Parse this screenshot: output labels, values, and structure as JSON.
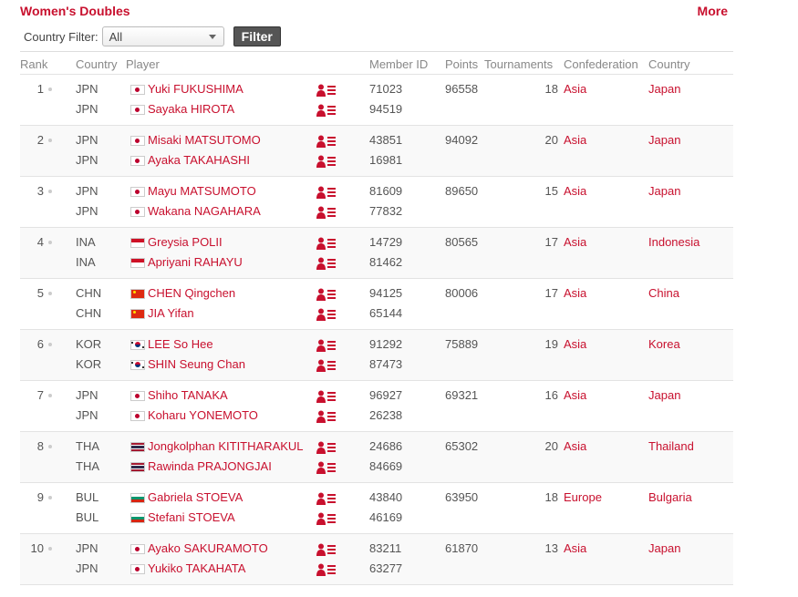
{
  "header": {
    "title": "Women's Doubles",
    "more": "More"
  },
  "filter": {
    "label": "Country Filter:",
    "selected": "All",
    "button": "Filter"
  },
  "columns": {
    "rank": "Rank",
    "country_code": "Country",
    "player": "Player",
    "member_id": "Member ID",
    "points": "Points",
    "tournaments": "Tournaments",
    "confederation": "Confederation",
    "country": "Country"
  },
  "icons": {
    "flag": "country-flag-icon",
    "profile": "player-profile-icon",
    "dot": "rank-change-dot-icon"
  },
  "colors": {
    "accent": "#c8102e"
  },
  "rows": [
    {
      "rank": "1",
      "points": "96558",
      "tournaments": "18",
      "confederation": "Asia",
      "country": "Japan",
      "players": [
        {
          "code": "JPN",
          "flag": "jp",
          "name": "Yuki FUKUSHIMA",
          "member_id": "71023"
        },
        {
          "code": "JPN",
          "flag": "jp",
          "name": "Sayaka HIROTA",
          "member_id": "94519"
        }
      ]
    },
    {
      "rank": "2",
      "points": "94092",
      "tournaments": "20",
      "confederation": "Asia",
      "country": "Japan",
      "players": [
        {
          "code": "JPN",
          "flag": "jp",
          "name": "Misaki MATSUTOMO",
          "member_id": "43851"
        },
        {
          "code": "JPN",
          "flag": "jp",
          "name": "Ayaka TAKAHASHI",
          "member_id": "16981"
        }
      ]
    },
    {
      "rank": "3",
      "points": "89650",
      "tournaments": "15",
      "confederation": "Asia",
      "country": "Japan",
      "players": [
        {
          "code": "JPN",
          "flag": "jp",
          "name": "Mayu MATSUMOTO",
          "member_id": "81609"
        },
        {
          "code": "JPN",
          "flag": "jp",
          "name": "Wakana NAGAHARA",
          "member_id": "77832"
        }
      ]
    },
    {
      "rank": "4",
      "points": "80565",
      "tournaments": "17",
      "confederation": "Asia",
      "country": "Indonesia",
      "players": [
        {
          "code": "INA",
          "flag": "id",
          "name": "Greysia POLII",
          "member_id": "14729"
        },
        {
          "code": "INA",
          "flag": "id",
          "name": "Apriyani RAHAYU",
          "member_id": "81462"
        }
      ]
    },
    {
      "rank": "5",
      "points": "80006",
      "tournaments": "17",
      "confederation": "Asia",
      "country": "China",
      "players": [
        {
          "code": "CHN",
          "flag": "cn",
          "name": "CHEN Qingchen",
          "member_id": "94125"
        },
        {
          "code": "CHN",
          "flag": "cn",
          "name": "JIA Yifan",
          "member_id": "65144"
        }
      ]
    },
    {
      "rank": "6",
      "points": "75889",
      "tournaments": "19",
      "confederation": "Asia",
      "country": "Korea",
      "players": [
        {
          "code": "KOR",
          "flag": "kr",
          "name": "LEE So Hee",
          "member_id": "91292"
        },
        {
          "code": "KOR",
          "flag": "kr",
          "name": "SHIN Seung Chan",
          "member_id": "87473"
        }
      ]
    },
    {
      "rank": "7",
      "points": "69321",
      "tournaments": "16",
      "confederation": "Asia",
      "country": "Japan",
      "players": [
        {
          "code": "JPN",
          "flag": "jp",
          "name": "Shiho TANAKA",
          "member_id": "96927"
        },
        {
          "code": "JPN",
          "flag": "jp",
          "name": "Koharu YONEMOTO",
          "member_id": "26238"
        }
      ]
    },
    {
      "rank": "8",
      "points": "65302",
      "tournaments": "20",
      "confederation": "Asia",
      "country": "Thailand",
      "players": [
        {
          "code": "THA",
          "flag": "th",
          "name": "Jongkolphan KITITHARAKUL",
          "member_id": "24686"
        },
        {
          "code": "THA",
          "flag": "th",
          "name": "Rawinda PRAJONGJAI",
          "member_id": "84669"
        }
      ]
    },
    {
      "rank": "9",
      "points": "63950",
      "tournaments": "18",
      "confederation": "Europe",
      "country": "Bulgaria",
      "players": [
        {
          "code": "BUL",
          "flag": "bg",
          "name": "Gabriela STOEVA",
          "member_id": "43840"
        },
        {
          "code": "BUL",
          "flag": "bg",
          "name": "Stefani STOEVA",
          "member_id": "46169"
        }
      ]
    },
    {
      "rank": "10",
      "points": "61870",
      "tournaments": "13",
      "confederation": "Asia",
      "country": "Japan",
      "players": [
        {
          "code": "JPN",
          "flag": "jp",
          "name": "Ayako SAKURAMOTO",
          "member_id": "83211"
        },
        {
          "code": "JPN",
          "flag": "jp",
          "name": "Yukiko TAKAHATA",
          "member_id": "63277"
        }
      ]
    }
  ]
}
